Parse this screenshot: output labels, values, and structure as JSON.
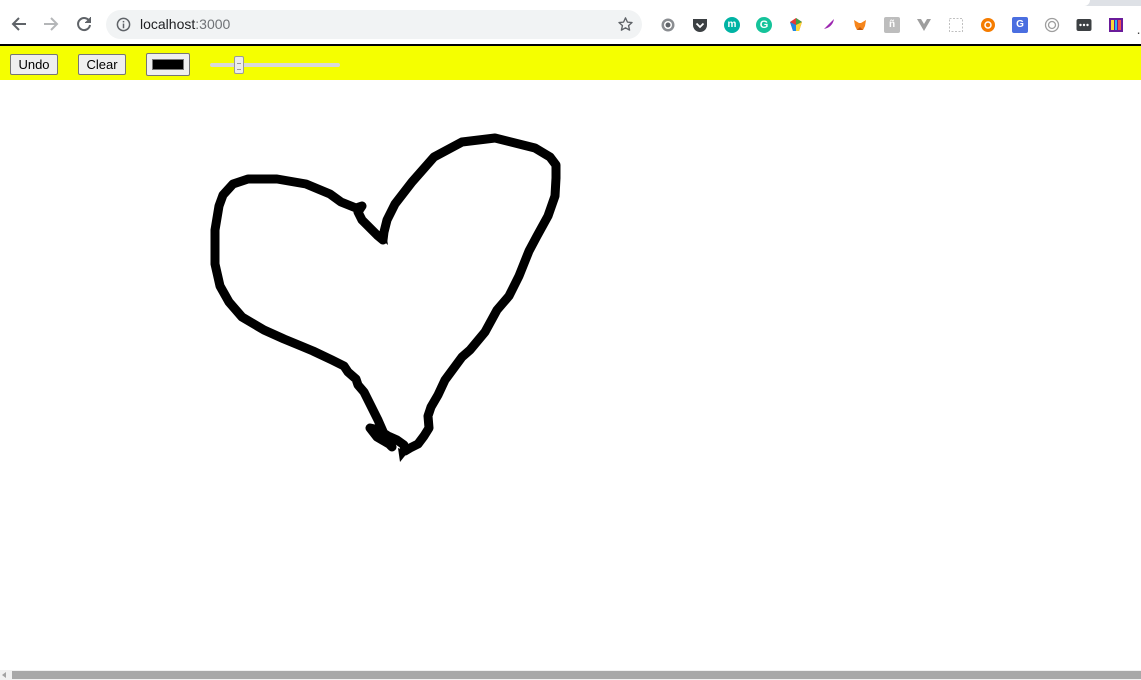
{
  "browser": {
    "url_host": "localhost",
    "url_port": ":3000",
    "nav_icons": [
      "back-icon",
      "forward-icon",
      "reload-icon"
    ],
    "omnibox_icons": [
      "site-info-icon",
      "bookmark-star-icon"
    ],
    "extensions": [
      {
        "name": "settings-gear-extension-icon",
        "color": "#5f6368"
      },
      {
        "name": "pocket-extension-icon",
        "color": "#3c4043"
      },
      {
        "name": "m-extension-icon",
        "color": "#00b3a4",
        "glyph": "m"
      },
      {
        "name": "grammarly-extension-icon",
        "color": "#15c39a",
        "glyph": "G"
      },
      {
        "name": "color-wheel-extension-icon",
        "color": "#e91e63"
      },
      {
        "name": "feather-extension-icon",
        "color": "#9c27b0"
      },
      {
        "name": "metamask-extension-icon",
        "color": "#f6851b"
      },
      {
        "name": "translate-n-extension-icon",
        "color": "#9e9e9e",
        "glyph": "ñ"
      },
      {
        "name": "vue-devtools-extension-icon",
        "color": "#9e9e9e"
      },
      {
        "name": "dashed-box-extension-icon",
        "color": "#c0c0c0"
      },
      {
        "name": "orange-circle-extension-icon",
        "color": "#f57c00"
      },
      {
        "name": "google-translate-extension-icon",
        "color": "#4a6ee0",
        "glyph": "G"
      },
      {
        "name": "target-extension-icon",
        "color": "#9e9e9e"
      },
      {
        "name": "dots-extension-icon",
        "color": "#3c4043"
      },
      {
        "name": "colorful-bars-extension-icon",
        "color": "#8e24aa"
      }
    ]
  },
  "app": {
    "undo_label": "Undo",
    "clear_label": "Clear",
    "toolbar_color": "#f5ff00",
    "brush_color": "#000000",
    "brush_size_fraction": 0.2
  }
}
